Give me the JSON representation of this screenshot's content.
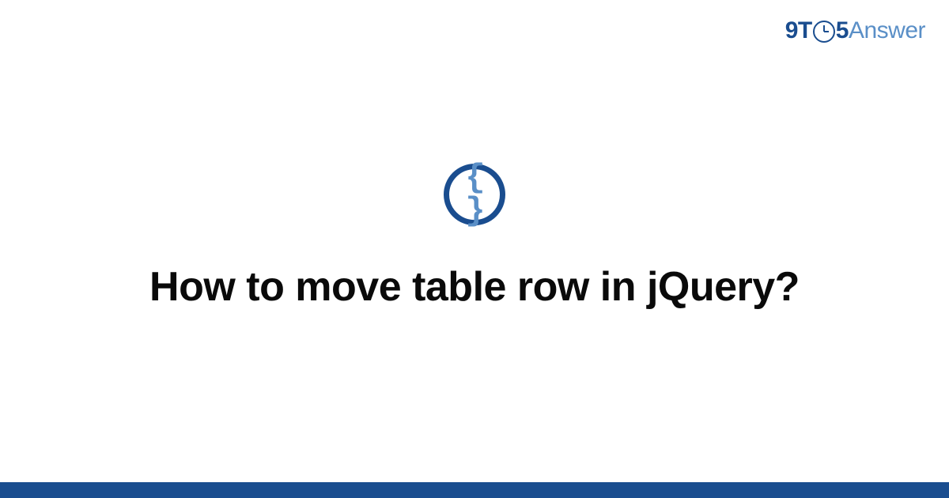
{
  "logo": {
    "part1": "9T",
    "part2": "5",
    "part3": "Answer"
  },
  "icon": {
    "name": "code-braces-icon",
    "glyph": "{ }"
  },
  "question": {
    "title": "How to move table row in jQuery?"
  },
  "colors": {
    "primary": "#1a4d8f",
    "accent": "#5a8fc7"
  }
}
